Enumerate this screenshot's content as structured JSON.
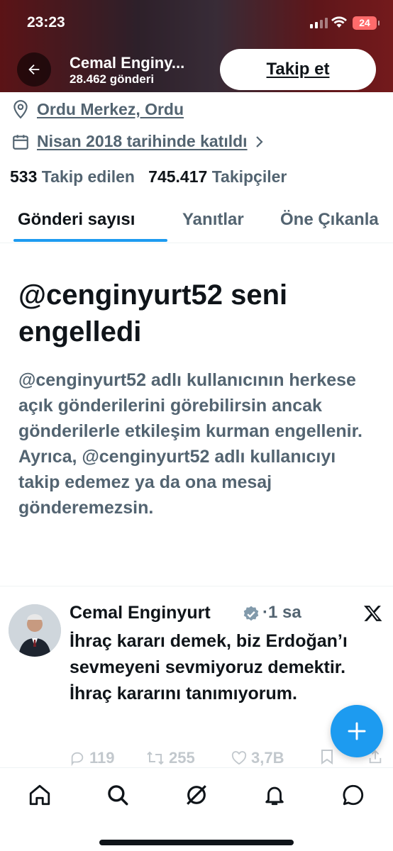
{
  "status_bar": {
    "time": "23:23",
    "battery": "24"
  },
  "header": {
    "name": "Cemal Enginy...",
    "post_count": "28.462 gönderi",
    "follow_label": "Takip et"
  },
  "profile": {
    "location": "Ordu Merkez, Ordu",
    "joined": "Nisan 2018 tarihinde katıldı",
    "following_count": "533",
    "following_label": "Takip edilen",
    "followers_count": "745.417",
    "followers_label": "Takipçiler"
  },
  "tabs": [
    {
      "label": "Gönderi sayısı",
      "active": true
    },
    {
      "label": "Yanıtlar"
    },
    {
      "label": "Öne Çıkanla"
    }
  ],
  "blocked": {
    "title": "@cenginyurt52 seni engelledi",
    "body": "@cenginyurt52 adlı kullanıcının herkese açık gönderilerini görebilirsin ancak gönderilerle etkileşim kurman engellenir. Ayrıca, @cenginyurt52 adlı kullanıcıyı takip edemez ya da ona mesaj gönderemezsin."
  },
  "tweet": {
    "author": "Cemal Enginyurt",
    "time": "·1 sa",
    "text": "İhraç kararı demek, biz Erdoğan’ı sevmeyeni sevmiyoruz demektir. İhraç kararını tanımıyorum.",
    "replies": "119",
    "retweets": "255",
    "likes": "3,7B"
  },
  "colors": {
    "accent": "#1d9bf0",
    "secondary_text": "#536471",
    "primary_text": "#0f1419"
  },
  "icons": [
    "back-arrow-icon",
    "location-pin-icon",
    "calendar-icon",
    "chevron-right-icon",
    "verified-badge-icon",
    "x-logo-icon",
    "compose-plus-icon",
    "home-icon",
    "search-icon",
    "grok-icon",
    "notifications-icon",
    "messages-icon"
  ]
}
